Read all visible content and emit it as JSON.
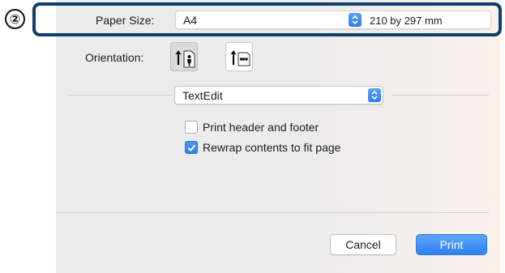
{
  "step_marker": "②",
  "paper_size": {
    "label": "Paper Size:",
    "value": "A4",
    "dimensions": "210 by 297 mm"
  },
  "orientation": {
    "label": "Orientation:",
    "options": [
      "portrait-icon",
      "landscape-icon"
    ],
    "selected": "portrait"
  },
  "app_menu": {
    "value": "TextEdit"
  },
  "options": [
    {
      "label": "Print header and footer",
      "checked": false
    },
    {
      "label": "Rewrap contents to fit page",
      "checked": true
    }
  ],
  "buttons": {
    "cancel": "Cancel",
    "print": "Print"
  },
  "colors": {
    "highlight_border": "#0c3f6e",
    "accent": "#2f80f2"
  }
}
